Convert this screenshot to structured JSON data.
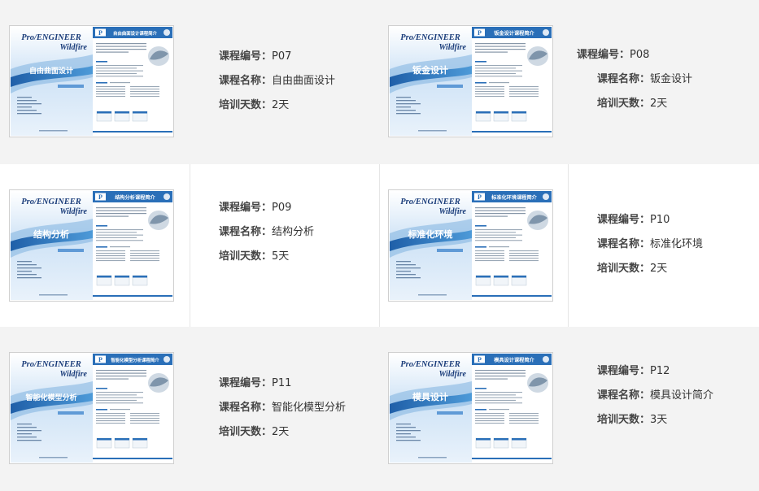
{
  "labels": {
    "code": "课程编号：",
    "name": "课程名称：",
    "days": "培训天数："
  },
  "cover": {
    "brand": "Pro/ENGINEER",
    "sub": "Wildfire",
    "page_header_suffix": "课程简介"
  },
  "courses": [
    {
      "code": "P07",
      "name": "自由曲面设计",
      "days": "2天",
      "cover_title": "自由曲面设计",
      "page_title": "自由曲面设计课程简介"
    },
    {
      "code": "P08",
      "name": "钣金设计",
      "days": "2天",
      "cover_title": "钣金设计",
      "page_title": "钣金设计课程简介"
    },
    {
      "code": "P09",
      "name": "结构分析",
      "days": "5天",
      "cover_title": "结构分析",
      "page_title": "结构分析课程简介"
    },
    {
      "code": "P10",
      "name": "标准化环境",
      "days": "2天",
      "cover_title": "标准化环境",
      "page_title": "标准化环境课程简介"
    },
    {
      "code": "P11",
      "name": "智能化模型分析",
      "days": "2天",
      "cover_title": "智能化模型分析",
      "page_title": "智能化模型分析课程简介"
    },
    {
      "code": "P12",
      "name": "模具设计简介",
      "days": "3天",
      "cover_title": "模具设计",
      "page_title": "模具设计课程简介"
    }
  ],
  "colors": {
    "band": "#f3f3f3",
    "brochure_blue": "#2a6fb8",
    "brand_text": "#1b3d7a"
  }
}
